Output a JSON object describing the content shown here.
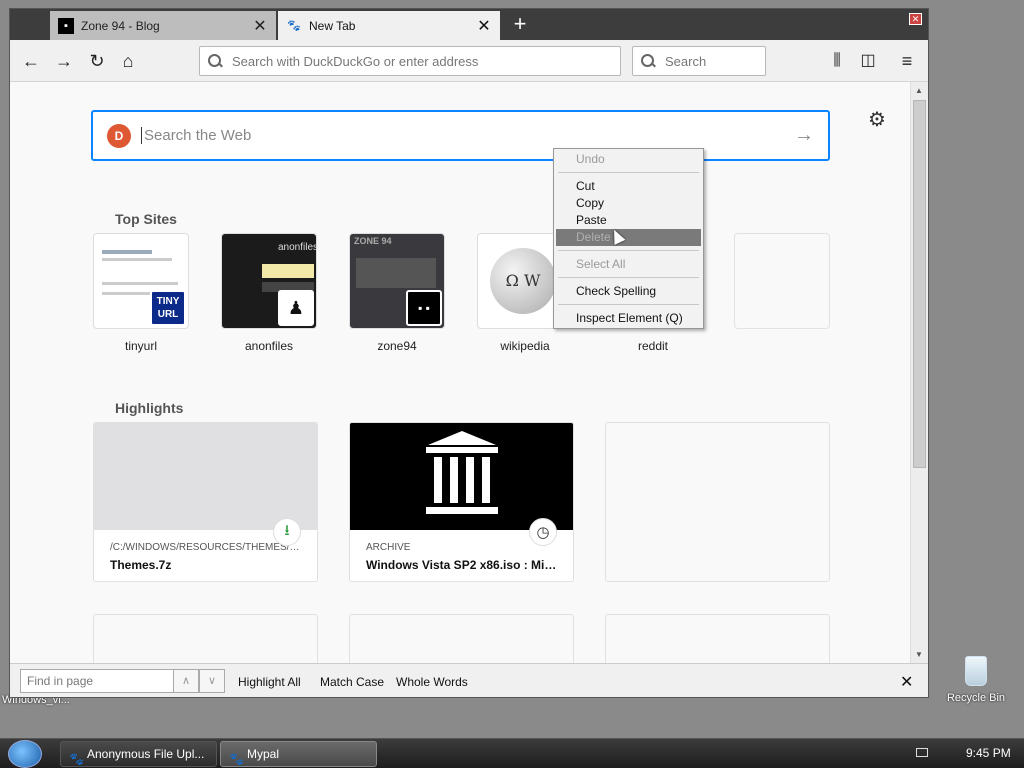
{
  "desktop": {
    "left_label": "Windows_vi...",
    "recycle_bin": "Recycle Bin"
  },
  "tabs": [
    {
      "label": "Zone 94 - Blog",
      "icon": "terminal-icon",
      "active": false
    },
    {
      "label": "New Tab",
      "icon": "mypal-icon",
      "active": true
    }
  ],
  "toolbar": {
    "url_placeholder": "Search with DuckDuckGo or enter address",
    "search_placeholder": "Search"
  },
  "newtab": {
    "search_placeholder": "Search the Web",
    "search_logo": "D",
    "top_sites_title": "Top Sites",
    "top_sites": [
      {
        "label": "tinyurl",
        "badge_text": "TINY URL"
      },
      {
        "label": "anonfiles",
        "thumb_text": "anonfiles"
      },
      {
        "label": "zone94",
        "thumb_text": "ZONE 94"
      },
      {
        "label": "wikipedia"
      },
      {
        "label": "reddit"
      }
    ],
    "highlights_title": "Highlights",
    "highlights": [
      {
        "source": "/C:/WINDOWS/RESOURCES/THEMES/THE...",
        "title": "Themes.7z",
        "icon": "download-icon"
      },
      {
        "source": "ARCHIVE",
        "title": "Windows Vista SP2 x86.iso : Micr...",
        "icon": "clock-icon"
      }
    ]
  },
  "context_menu": {
    "undo": "Undo",
    "cut": "Cut",
    "copy": "Copy",
    "paste": "Paste",
    "delete": "Delete",
    "select_all": "Select All",
    "check_spelling": "Check Spelling",
    "inspect": "Inspect Element (Q)"
  },
  "findbar": {
    "placeholder": "Find in page",
    "highlight_all": "Highlight All",
    "match_case": "Match Case",
    "whole_words": "Whole Words"
  },
  "taskbar": {
    "items": [
      {
        "label": "Anonymous File Upl...",
        "active": false
      },
      {
        "label": "Mypal",
        "active": true
      }
    ],
    "clock": "9:45 PM"
  }
}
